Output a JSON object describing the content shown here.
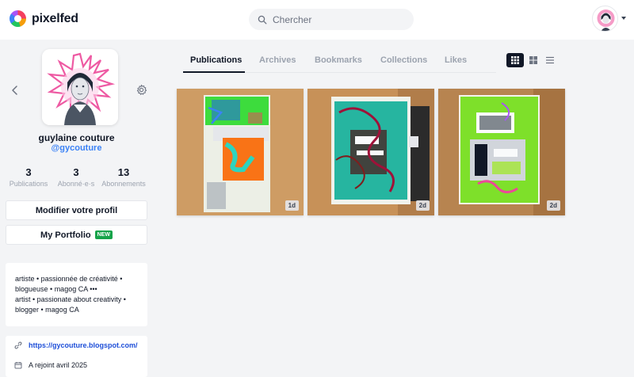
{
  "app": {
    "name": "pixelfed"
  },
  "search": {
    "placeholder": "Chercher"
  },
  "profile": {
    "display_name": "guylaine couture",
    "username": "@gycouture",
    "stats": [
      {
        "value": "3",
        "label": "Publications"
      },
      {
        "value": "3",
        "label": "Abonné·e·s"
      },
      {
        "value": "13",
        "label": "Abonnements"
      }
    ],
    "edit_profile_label": "Modifier votre profil",
    "portfolio_label": "My Portfolio",
    "portfolio_badge": "NEW",
    "bio_lines": [
      "artiste • passionnée de créativité •",
      "blogueuse • magog CA •••",
      "artist • passionate about creativity •",
      "blogger • magog CA"
    ],
    "website": "https://gycouture.blogspot.com/",
    "joined": "A rejoint avril 2025"
  },
  "tabs": [
    {
      "label": "Publications",
      "active": true
    },
    {
      "label": "Archives",
      "active": false
    },
    {
      "label": "Bookmarks",
      "active": false
    },
    {
      "label": "Collections",
      "active": false
    },
    {
      "label": "Likes",
      "active": false
    }
  ],
  "view_modes": [
    {
      "icon": "grid-3-icon",
      "active": true
    },
    {
      "icon": "grid-2-icon",
      "active": false
    },
    {
      "icon": "list-icon",
      "active": false
    }
  ],
  "posts": [
    {
      "age": "1d"
    },
    {
      "age": "2d"
    },
    {
      "age": "2d"
    }
  ],
  "icons": {
    "logo": "pixelfed-logo-icon",
    "search": "search-icon",
    "back": "chevron-left-icon",
    "settings": "gear-icon",
    "link": "link-icon",
    "calendar": "calendar-icon",
    "caret": "caret-down-icon"
  },
  "colors": {
    "accent": "#3b82f6",
    "link": "#1d4ed8",
    "badge_green": "#16a34a",
    "background": "#f3f4f6"
  }
}
